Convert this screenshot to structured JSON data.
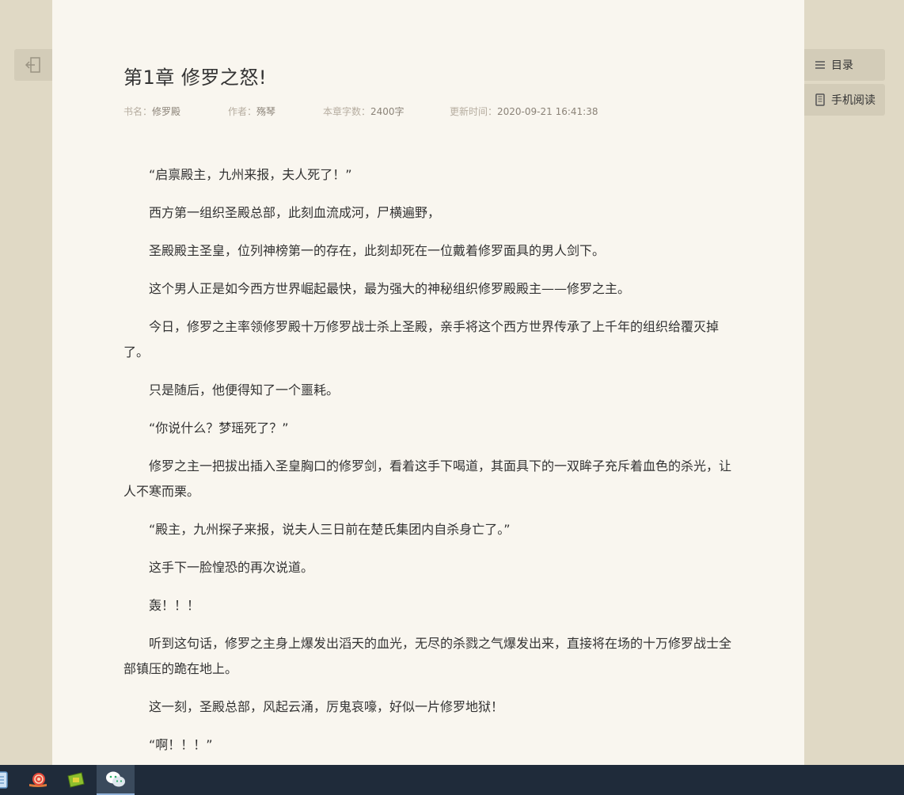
{
  "chapter": {
    "title": "第1章 修罗之怒!",
    "meta": {
      "book_label": "书名：",
      "book_value": "修罗殿",
      "author_label": "作者：",
      "author_value": "殇琴",
      "words_label": "本章字数：",
      "words_value": "2400字",
      "updated_label": "更新时间：",
      "updated_value": "2020-09-21 16:41:38"
    },
    "paragraphs": [
      "“启禀殿主，九州来报，夫人死了！”",
      "西方第一组织圣殿总部，此刻血流成河，尸横遍野，",
      "圣殿殿主圣皇，位列神榜第一的存在，此刻却死在一位戴着修罗面具的男人剑下。",
      "这个男人正是如今西方世界崛起最快，最为强大的神秘组织修罗殿殿主——修罗之主。",
      "今日，修罗之主率领修罗殿十万修罗战士杀上圣殿，亲手将这个西方世界传承了上千年的组织给覆灭掉了。",
      "只是随后，他便得知了一个噩耗。",
      "“你说什么？梦瑶死了？”",
      "修罗之主一把拔出插入圣皇胸口的修罗剑，看着这手下喝道，其面具下的一双眸子充斥着血色的杀光，让人不寒而栗。",
      "“殿主，九州探子来报，说夫人三日前在楚氏集团内自杀身亡了。”",
      "这手下一脸惶恐的再次说道。",
      "轰！！！",
      "听到这句话，修罗之主身上爆发出滔天的血光，无尽的杀戮之气爆发出来，直接将在场的十万修罗战士全部镇压的跪在地上。",
      "这一刻，圣殿总部，风起云涌，厉鬼哀嚎，好似一片修罗地狱！",
      "“啊！！！”"
    ]
  },
  "sidebar": {
    "toc_label": "目录",
    "mobile_label": "手机阅读"
  },
  "colors": {
    "background": "#e0d9c5",
    "paper": "#f9f6ef",
    "button": "#d3ccb8",
    "taskbar": "#1f2b3a"
  }
}
